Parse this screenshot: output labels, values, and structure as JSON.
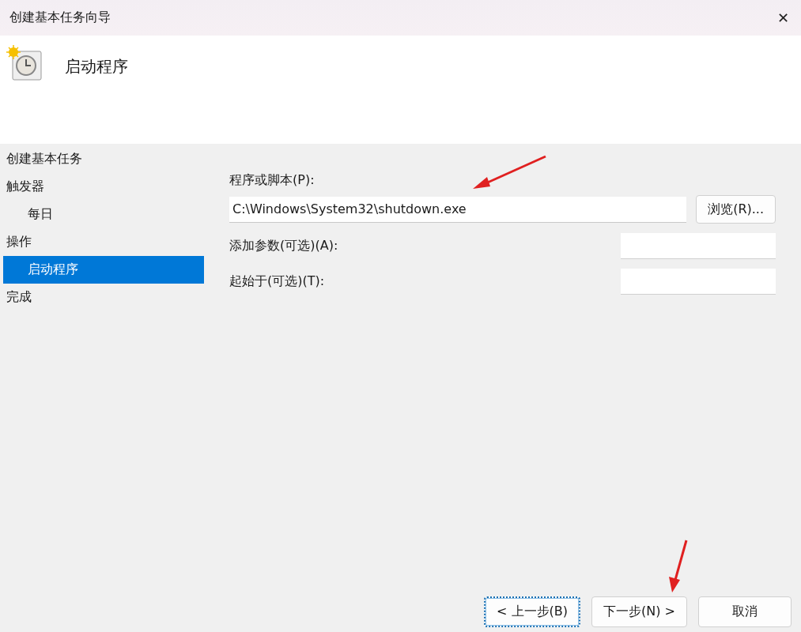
{
  "window": {
    "title": "创建基本任务向导",
    "close": "✕"
  },
  "header": {
    "title": "启动程序"
  },
  "sidebar": {
    "items": [
      {
        "label": "创建基本任务",
        "selected": false
      },
      {
        "label": "触发器",
        "selected": false,
        "children": [
          {
            "label": "每日",
            "selected": false
          }
        ]
      },
      {
        "label": "操作",
        "selected": false,
        "children": [
          {
            "label": "启动程序",
            "selected": true
          }
        ]
      },
      {
        "label": "完成",
        "selected": false
      }
    ]
  },
  "form": {
    "program_label": "程序或脚本(P):",
    "program_value": "C:\\Windows\\System32\\shutdown.exe",
    "browse_button": "浏览(R)...",
    "args_label": "添加参数(可选)(A):",
    "start_label": "起始于(可选)(T):"
  },
  "buttons": [
    {
      "label": "< 上一步(B)",
      "kind": "focused"
    },
    {
      "label": "下一步(N) >",
      "kind": "normal"
    },
    {
      "label": "取消",
      "kind": "normal"
    }
  ]
}
